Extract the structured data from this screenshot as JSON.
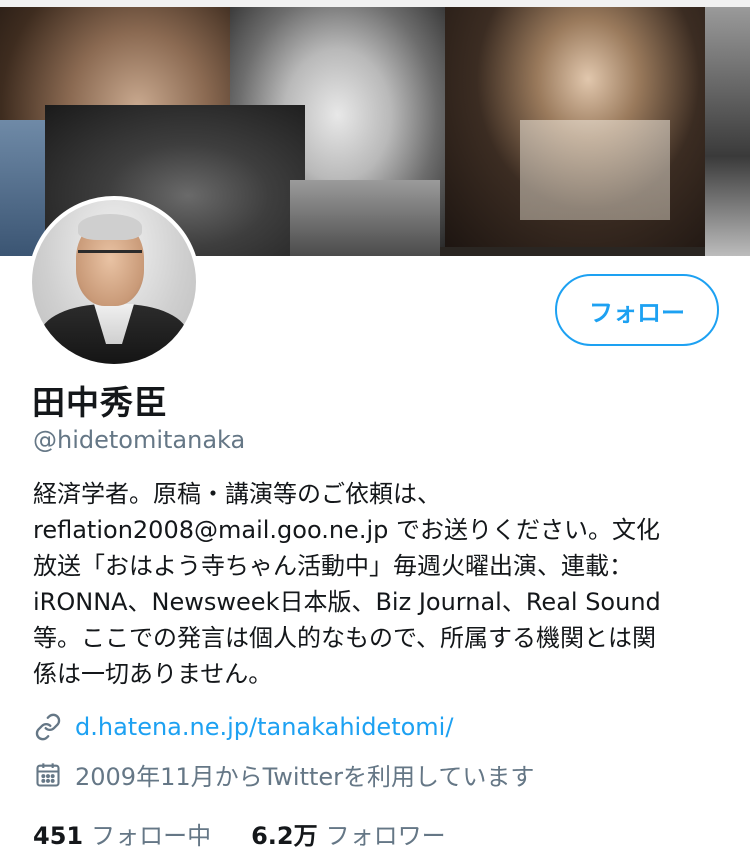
{
  "profile": {
    "display_name": "田中秀臣",
    "handle": "@hidetomitanaka",
    "follow_label": "フォロー",
    "bio_lines": [
      "経済学者。原稿・講演等のご依頼は、",
      "reflation2008@mail.goo.ne.jp でお送りください。文化",
      "放送「おはよう寺ちゃん活動中」毎週火曜出演、連載：",
      "iRONNA、Newsweek日本版、Biz Journal、Real Sound",
      "等。ここでの発言は個人的なもので、所属する機関とは関",
      "係は一切ありません。"
    ],
    "website": "d.hatena.ne.jp/tanakahidetomi/",
    "joined": "2009年11月からTwitterを利用しています",
    "following_count": "451",
    "following_label": "フォロー中",
    "followers_count": "6.2万",
    "followers_label": "フォロワー"
  },
  "icons": {
    "link": "link-icon",
    "calendar": "calendar-icon"
  },
  "colors": {
    "accent": "#1da1f2",
    "secondary_text": "#657786",
    "primary_text": "#14171a"
  }
}
